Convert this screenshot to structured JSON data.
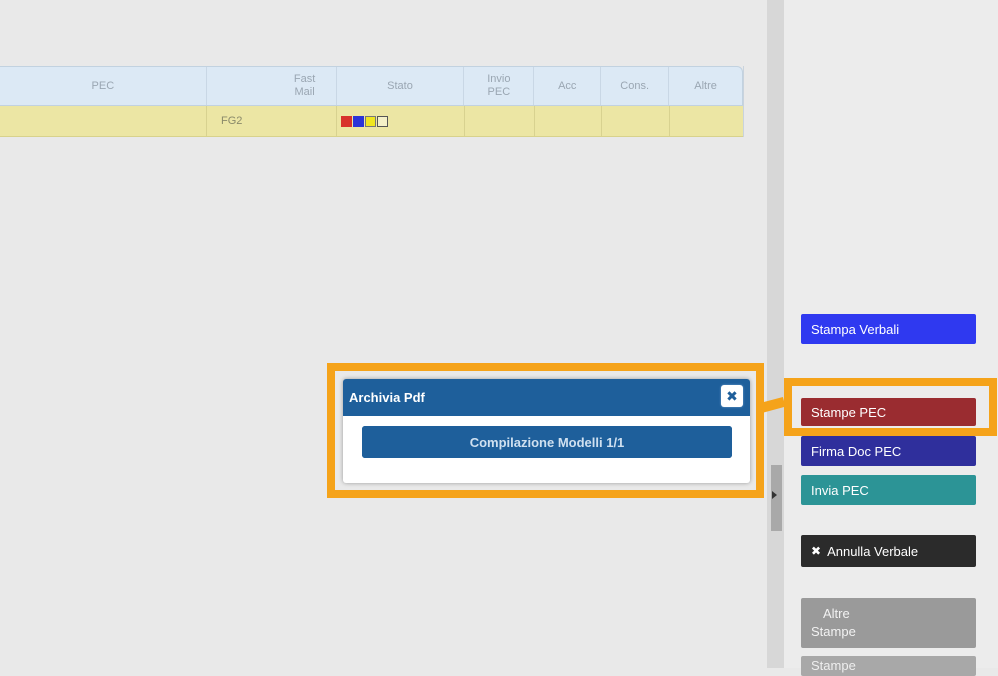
{
  "table": {
    "headers": [
      "PEC",
      "Fast Mail",
      "Stato",
      "Invio PEC",
      "Acc",
      "Cons.",
      "Altre"
    ],
    "row": {
      "fast_mail": "FG2"
    },
    "status_colors": [
      "#d8322b",
      "#2b34d8",
      "#f0e620",
      "#f4f0c8"
    ]
  },
  "modal": {
    "title": "Archivia Pdf",
    "close_label": "✖",
    "progress_label": "Compilazione Modelli 1/1",
    "progress_fraction": 1.0
  },
  "side_buttons": [
    {
      "label": "Stampa Verbali",
      "color": "#2f39f0"
    },
    {
      "label": "Stampe PEC",
      "color": "#9a2c30"
    },
    {
      "label": "Firma Doc PEC",
      "color": "#2f2f9c"
    },
    {
      "label": "Invia PEC",
      "color": "#2c9496"
    },
    {
      "label": "Annulla Verbale",
      "color": "#2b2b2b",
      "icon": "close-icon",
      "icon_glyph": "✖"
    },
    {
      "label_line1": "Altre",
      "label_line2": "Stampe",
      "color": "#9a9a9a"
    },
    {
      "label": "Stampe",
      "color": "#a8a8a8"
    }
  ],
  "highlight_color": "#f5a31a"
}
